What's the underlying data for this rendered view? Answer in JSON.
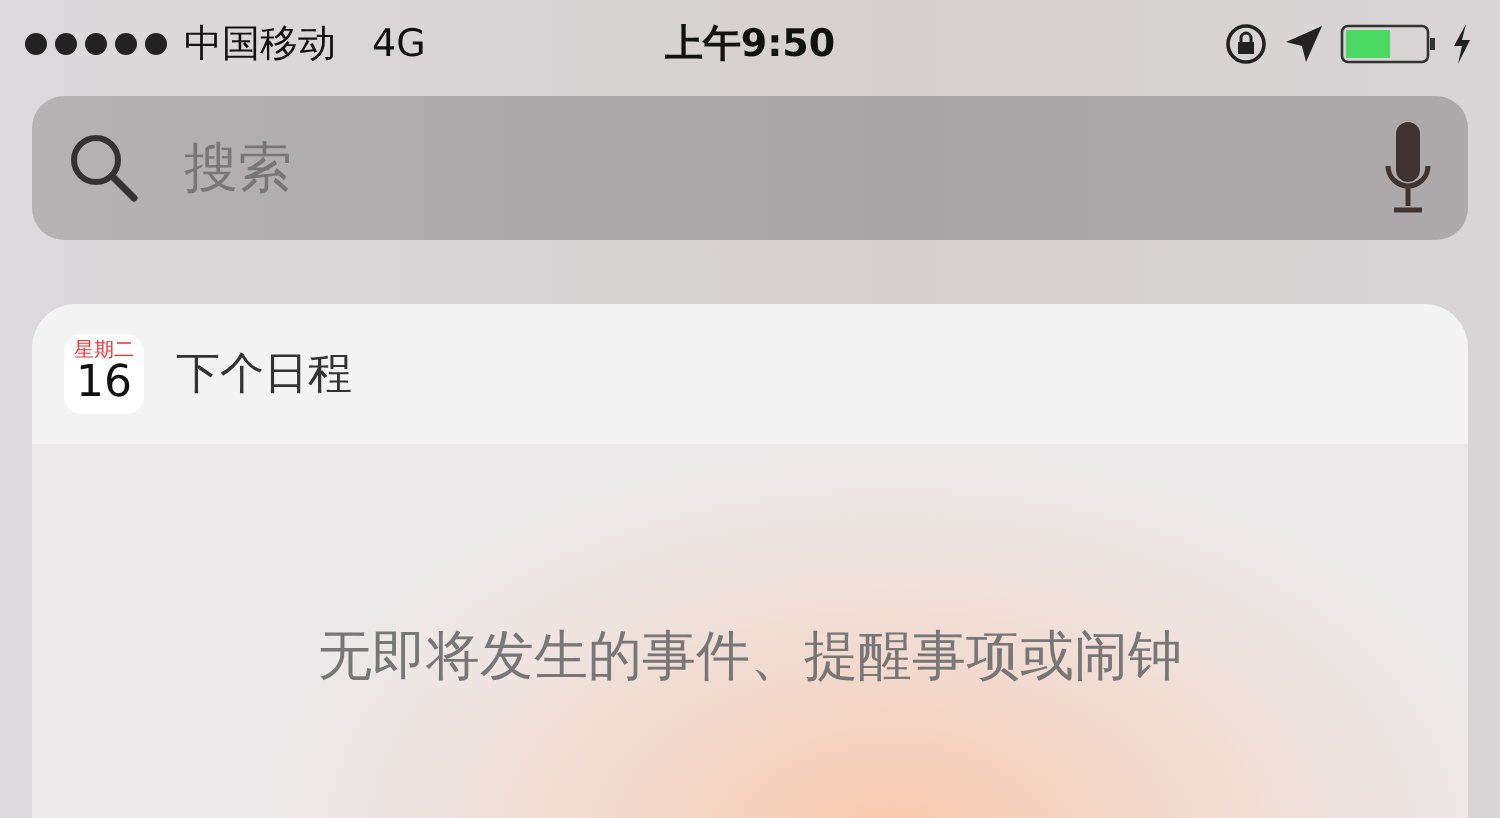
{
  "status_bar": {
    "carrier": "中国移动",
    "network": "4G",
    "time": "上午9:50"
  },
  "search": {
    "placeholder": "搜索"
  },
  "widget": {
    "calendar_weekday": "星期二",
    "calendar_day": "16",
    "title": "下个日程",
    "message": "无即将发生的事件、提醒事项或闹钟"
  }
}
